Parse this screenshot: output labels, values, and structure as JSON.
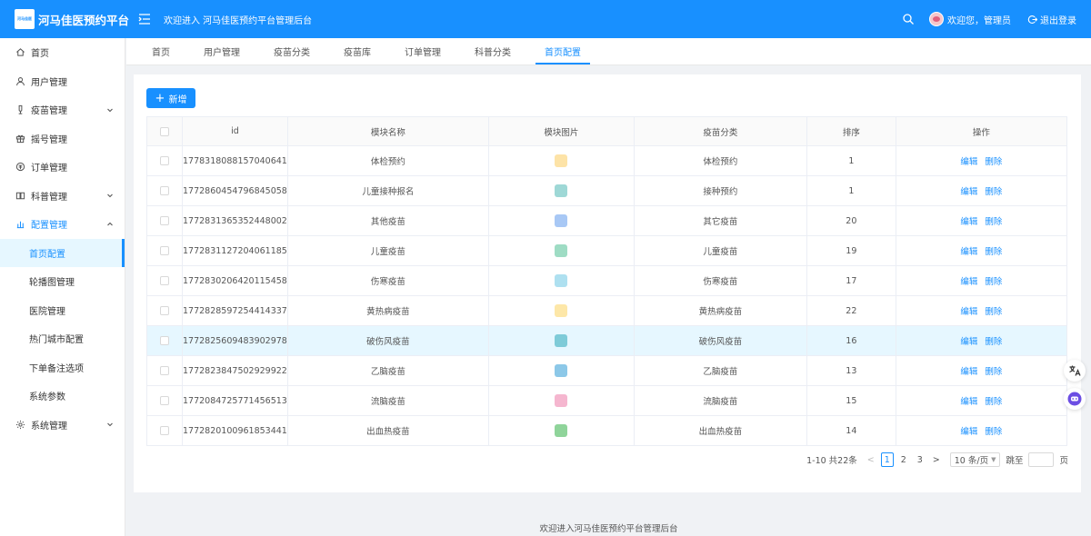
{
  "header": {
    "logo_small": "河马佳医",
    "app_title": "河马佳医预约平台",
    "welcome": "欢迎进入 河马佳医预约平台管理后台",
    "user_greeting": "欢迎您，管理员",
    "logout": "退出登录"
  },
  "sidebar": {
    "items": [
      {
        "label": "首页",
        "icon": "home-icon"
      },
      {
        "label": "用户管理",
        "icon": "user-icon"
      },
      {
        "label": "疫苗管理",
        "icon": "vaccine-icon"
      },
      {
        "label": "摇号管理",
        "icon": "gift-icon"
      },
      {
        "label": "订单管理",
        "icon": "order-icon"
      },
      {
        "label": "科普管理",
        "icon": "book-icon"
      },
      {
        "label": "配置管理",
        "icon": "config-icon"
      },
      {
        "label": "首页配置"
      },
      {
        "label": "轮播图管理"
      },
      {
        "label": "医院管理"
      },
      {
        "label": "热门城市配置"
      },
      {
        "label": "下单备注选项"
      },
      {
        "label": "系统参数"
      },
      {
        "label": "系统管理",
        "icon": "gear-icon"
      }
    ]
  },
  "tabs": [
    "首页",
    "用户管理",
    "疫苗分类",
    "疫苗库",
    "订单管理",
    "科普分类",
    "首页配置"
  ],
  "toolbar": {
    "add_label": "新增"
  },
  "table": {
    "headers": [
      "id",
      "模块名称",
      "模块图片",
      "疫苗分类",
      "排序",
      "操作"
    ],
    "edit_label": "编辑",
    "delete_label": "删除",
    "rows": [
      {
        "id": "1778318088157040641",
        "name": "体检预约",
        "category": "体检预约",
        "sort": "1",
        "thumb_color": "#fde3a7"
      },
      {
        "id": "1772860454796845058",
        "name": "儿童接种报名",
        "category": "接种预约",
        "sort": "1",
        "thumb_color": "#9ed8d6"
      },
      {
        "id": "1772831365352448002",
        "name": "其他疫苗",
        "category": "其它疫苗",
        "sort": "20",
        "thumb_color": "#a8c8f5"
      },
      {
        "id": "1772831127204061185",
        "name": "儿童疫苗",
        "category": "儿童疫苗",
        "sort": "19",
        "thumb_color": "#9edcc4"
      },
      {
        "id": "1772830206420115458",
        "name": "伤寒疫苗",
        "category": "伤寒疫苗",
        "sort": "17",
        "thumb_color": "#aee0f0"
      },
      {
        "id": "1772828597254414337",
        "name": "黄热病疫苗",
        "category": "黄热病疫苗",
        "sort": "22",
        "thumb_color": "#fde7a8"
      },
      {
        "id": "1772825609483902978",
        "name": "破伤风疫苗",
        "category": "破伤风疫苗",
        "sort": "16",
        "thumb_color": "#7ecbd8"
      },
      {
        "id": "1772823847502929922",
        "name": "乙脑疫苗",
        "category": "乙脑疫苗",
        "sort": "13",
        "thumb_color": "#8cc8e8"
      },
      {
        "id": "1772084725771456513",
        "name": "流脑疫苗",
        "category": "流脑疫苗",
        "sort": "15",
        "thumb_color": "#f5b6cf"
      },
      {
        "id": "1772820100961853441",
        "name": "出血热疫苗",
        "category": "出血热疫苗",
        "sort": "14",
        "thumb_color": "#8fd49a"
      }
    ]
  },
  "pagination": {
    "summary": "1-10 共22条",
    "pages": [
      "1",
      "2",
      "3"
    ],
    "current": "1",
    "page_size": "10 条/页",
    "jump_label": "跳至",
    "page_unit": "页"
  },
  "footer": "欢迎进入河马佳医预约平台管理后台",
  "colors": {
    "primary": "#1890ff",
    "highlight_row": "#e6f7ff"
  }
}
